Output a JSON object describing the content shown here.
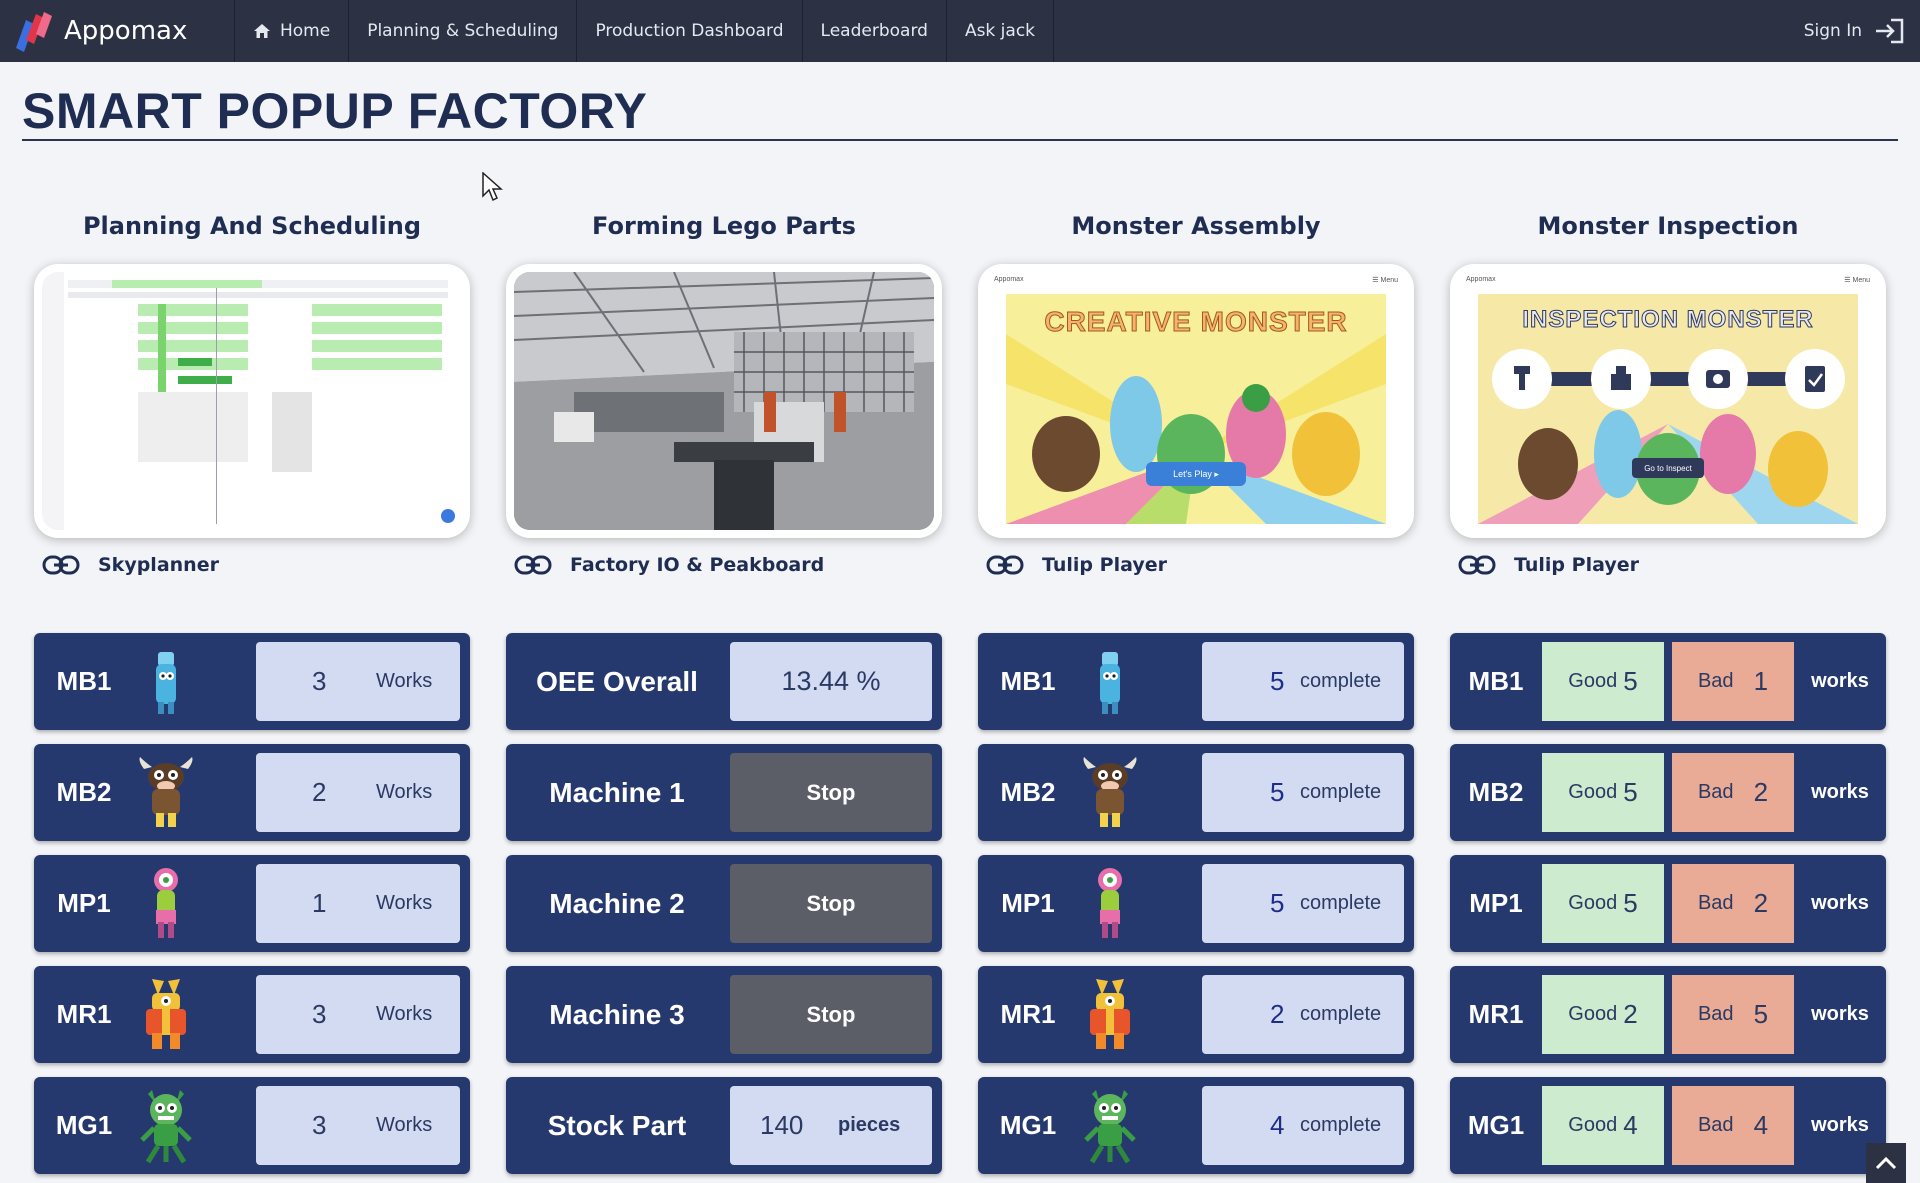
{
  "nav": {
    "brand": "Appomax",
    "items": [
      {
        "label": "Home"
      },
      {
        "label": "Planning & Scheduling"
      },
      {
        "label": "Production Dashboard"
      },
      {
        "label": "Leaderboard"
      },
      {
        "label": "Ask jack"
      }
    ],
    "sign_in": "Sign In"
  },
  "page_title": "SMART POPUP FACTORY",
  "stations": [
    {
      "title": "Planning And Scheduling",
      "link": "Skyplanner"
    },
    {
      "title": "Forming Lego Parts",
      "link": "Factory IO & Peakboard"
    },
    {
      "title": "Monster Assembly",
      "link": "Tulip Player",
      "banner": "CREATIVE MONSTER",
      "button": "Let's Play ▸"
    },
    {
      "title": "Monster Inspection",
      "link": "Tulip Player",
      "banner": "INSPECTION MONSTER",
      "button": "Go to Inspect"
    }
  ],
  "preview_menu": "☰ Menu",
  "preview_brand": "Appomax",
  "colors": {
    "navy": "#26396f",
    "value_bg": "#d3dbf2",
    "stop_bg": "#5b5e66",
    "good_bg": "#cdebcf",
    "bad_bg": "#e9aa96"
  },
  "planning": [
    {
      "code": "MB1",
      "icon": "blue-monster-icon",
      "value": "3",
      "unit": "Works"
    },
    {
      "code": "MB2",
      "icon": "cow-monster-icon",
      "value": "2",
      "unit": "Works"
    },
    {
      "code": "MP1",
      "icon": "pink-monster-icon",
      "value": "1",
      "unit": "Works"
    },
    {
      "code": "MR1",
      "icon": "red-monster-icon",
      "value": "3",
      "unit": "Works"
    },
    {
      "code": "MG1",
      "icon": "green-monster-icon",
      "value": "3",
      "unit": "Works"
    }
  ],
  "forming": {
    "oee_label": "OEE Overall",
    "oee_value": "13.44 %",
    "machines": [
      {
        "label": "Machine 1",
        "status": "Stop"
      },
      {
        "label": "Machine 2",
        "status": "Stop"
      },
      {
        "label": "Machine 3",
        "status": "Stop"
      }
    ],
    "stock_label": "Stock Part",
    "stock_value": "140",
    "stock_unit": "pieces"
  },
  "assembly": [
    {
      "code": "MB1",
      "icon": "blue-monster-icon",
      "value": "5",
      "unit": "complete"
    },
    {
      "code": "MB2",
      "icon": "cow-monster-icon",
      "value": "5",
      "unit": "complete"
    },
    {
      "code": "MP1",
      "icon": "pink-monster-icon",
      "value": "5",
      "unit": "complete"
    },
    {
      "code": "MR1",
      "icon": "red-monster-icon",
      "value": "2",
      "unit": "complete"
    },
    {
      "code": "MG1",
      "icon": "green-monster-icon",
      "value": "4",
      "unit": "complete"
    }
  ],
  "inspection": {
    "good_label": "Good",
    "bad_label": "Bad",
    "unit": "works",
    "rows": [
      {
        "code": "MB1",
        "good": "5",
        "bad": "1"
      },
      {
        "code": "MB2",
        "good": "5",
        "bad": "2"
      },
      {
        "code": "MP1",
        "good": "5",
        "bad": "2"
      },
      {
        "code": "MR1",
        "good": "2",
        "bad": "5"
      },
      {
        "code": "MG1",
        "good": "4",
        "bad": "4"
      }
    ]
  }
}
